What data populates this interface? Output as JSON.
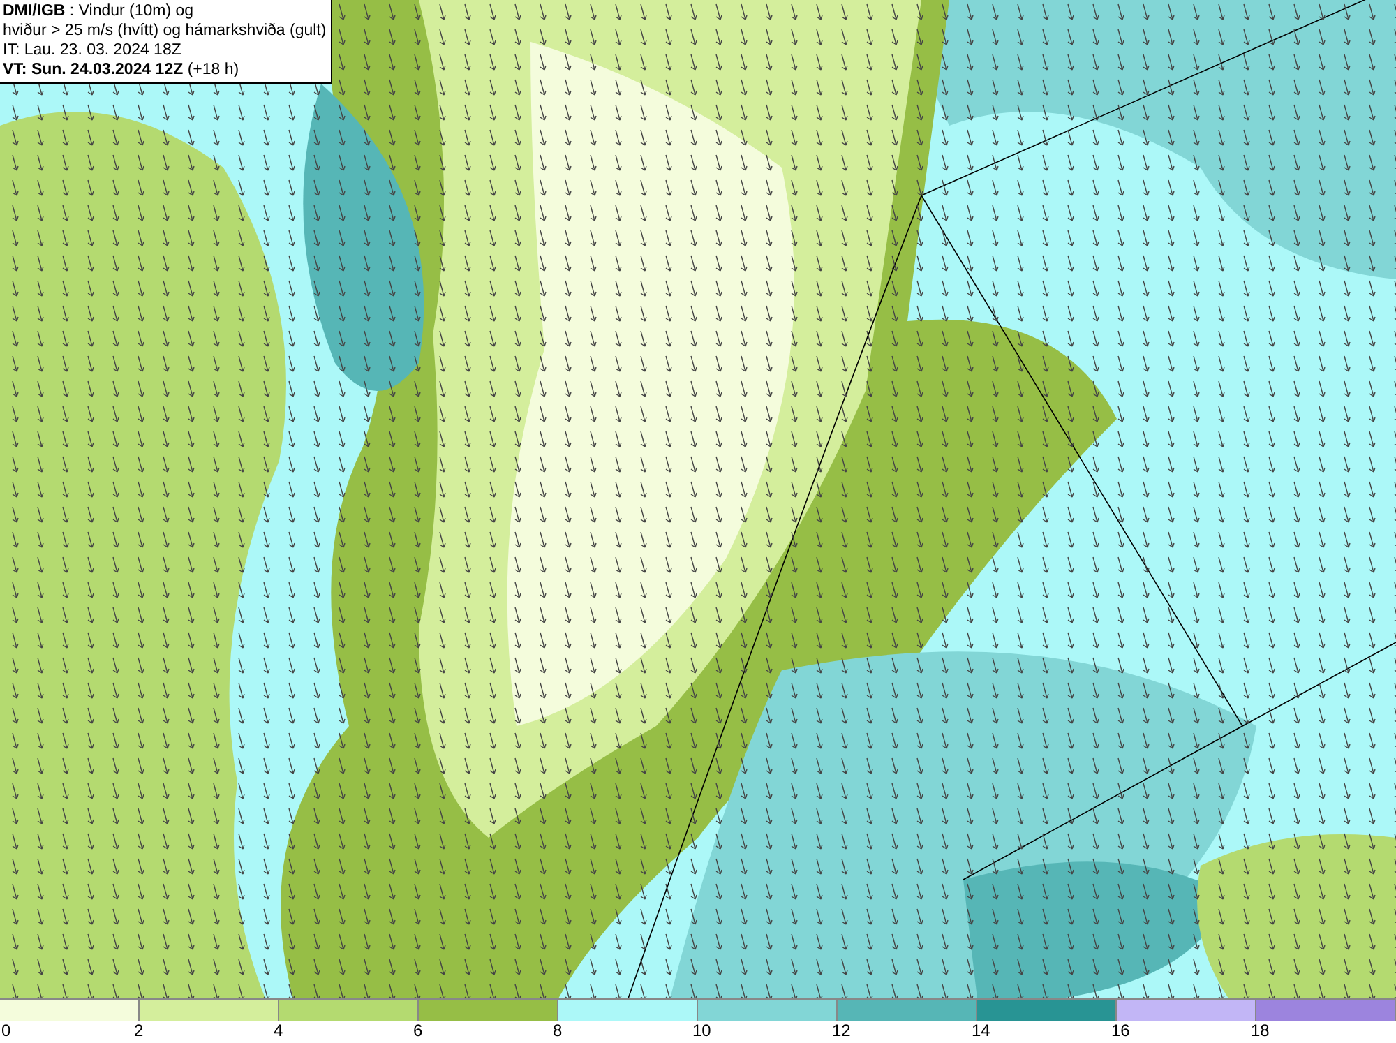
{
  "header": {
    "lines": [
      "**DMI/IGB** : Vindur (10m) og",
      "hviður > 25 m/s (hvítt) og hámarkshviða (gult)",
      "IT: Lau. 23. 03. 2024 18Z",
      "**VT: Sun. 24.03.2024 12Z** (+18 h)"
    ]
  },
  "legend": {
    "bins": [
      {
        "label": "0",
        "color": "#f4fcdc"
      },
      {
        "label": "2",
        "color": "#d4ee9c"
      },
      {
        "label": "4",
        "color": "#b4da70"
      },
      {
        "label": "6",
        "color": "#96be46"
      },
      {
        "label": "8",
        "color": "#acf8f8"
      },
      {
        "label": "10",
        "color": "#82d6d6"
      },
      {
        "label": "12",
        "color": "#56b6b6"
      },
      {
        "label": "14",
        "color": "#289494"
      },
      {
        "label": "16",
        "color": "#c2b6f6"
      },
      {
        "label": "18",
        "color": "#9c84de"
      }
    ]
  }
}
